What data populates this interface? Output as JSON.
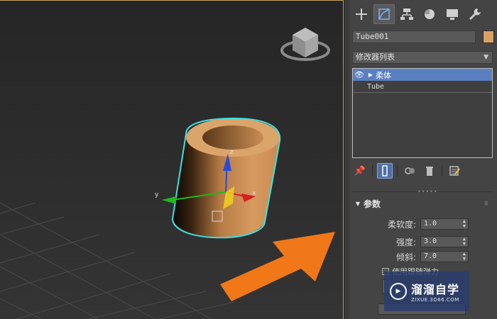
{
  "panel": {
    "tabs": [
      {
        "icon": "create-plus-icon"
      },
      {
        "icon": "modify-icon",
        "active": true
      },
      {
        "icon": "hierarchy-icon"
      },
      {
        "icon": "motion-icon"
      },
      {
        "icon": "display-icon"
      },
      {
        "icon": "utilities-wrench-icon"
      }
    ],
    "object_name": "Tube001",
    "object_color": "#d9a063",
    "modifier_list_label": "修改器列表",
    "stack": {
      "selected_modifier": "柔体",
      "base_object": "Tube"
    },
    "rollout_title": "参数",
    "params": {
      "softness_label": "柔软度:",
      "softness_value": "1.0",
      "strength_label": "强度:",
      "strength_value": "3.0",
      "sway_label": "倾斜:",
      "sway_value": "7.0",
      "checkbox_label": "使用跟随弹力"
    }
  },
  "watermark": {
    "title": "溜溜自学",
    "subtitle": "ZIXUE.3D66.COM"
  },
  "colors": {
    "accent": "#f07818",
    "selection": "#5a7fc0",
    "object": "#d9a063",
    "highlight": "#3fe0e0"
  }
}
